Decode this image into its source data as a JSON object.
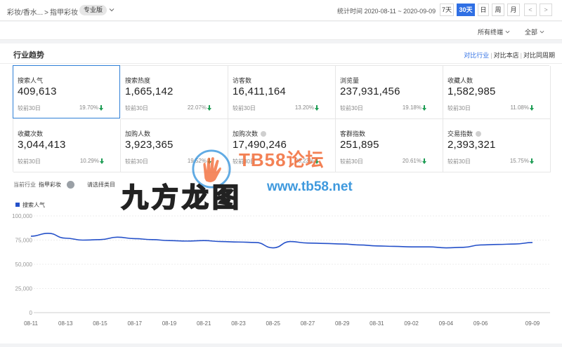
{
  "header": {
    "breadcrumb_1": "彩妆/香水...",
    "breadcrumb_sep": ">",
    "breadcrumb_2": "指甲彩妆",
    "edition_badge": "专业版",
    "stat_time": "统计时间 2020-08-11 ~ 2020-09-09",
    "ranges": [
      {
        "label": "7天",
        "active": false
      },
      {
        "label": "30天",
        "active": true
      },
      {
        "label": "日",
        "active": false
      },
      {
        "label": "周",
        "active": false
      },
      {
        "label": "月",
        "active": false
      },
      {
        "label": "<",
        "active": false
      },
      {
        "label": ">",
        "active": false
      }
    ]
  },
  "filters": {
    "terminal": "所有终端",
    "scope": "全部"
  },
  "panel": {
    "title": "行业趋势",
    "compare_industry": "对比行业",
    "compare_store": "对比本店",
    "compare_period": "对比同周期"
  },
  "metrics": [
    {
      "label": "搜索人气",
      "value": "409,613",
      "compare": "较前30日",
      "pct": "19.70%",
      "info": false,
      "selected": true
    },
    {
      "label": "搜索热度",
      "value": "1,665,142",
      "compare": "较前30日",
      "pct": "22.07%",
      "info": false,
      "selected": false
    },
    {
      "label": "访客数",
      "value": "16,411,164",
      "compare": "较前30日",
      "pct": "13.20%",
      "info": false,
      "selected": false
    },
    {
      "label": "浏览量",
      "value": "237,931,456",
      "compare": "较前30日",
      "pct": "19.18%",
      "info": false,
      "selected": false
    },
    {
      "label": "收藏人数",
      "value": "1,582,985",
      "compare": "较前30日",
      "pct": "11.08%",
      "info": false,
      "selected": false
    },
    {
      "label": "收藏次数",
      "value": "3,044,413",
      "compare": "较前30日",
      "pct": "10.29%",
      "info": false,
      "selected": false
    },
    {
      "label": "加购人数",
      "value": "3,923,365",
      "compare": "较前30日",
      "pct": "19.52%",
      "info": false,
      "selected": false
    },
    {
      "label": "加购次数",
      "value": "17,490,246",
      "compare": "较前30日",
      "pct": "20.23%",
      "info": true,
      "selected": false
    },
    {
      "label": "客群指数",
      "value": "251,895",
      "compare": "较前30日",
      "pct": "20.61%",
      "info": false,
      "selected": false
    },
    {
      "label": "交易指数",
      "value": "2,393,321",
      "compare": "较前30日",
      "pct": "15.75%",
      "info": true,
      "selected": false
    }
  ],
  "colors": {
    "accent": "#2f6fe4",
    "down_arrow": "#1f9d55",
    "series": "#2450c9"
  },
  "chart_header": {
    "current_label": "当前行业",
    "current_value": "指甲彩妆",
    "category_picker": "请选择类目"
  },
  "watermark": {
    "line1": "TB58论坛",
    "line2": "www.tb58.net",
    "line3": "九方龙图"
  },
  "chart_data": {
    "type": "line",
    "x": [
      "08-11",
      "08-12",
      "08-13",
      "08-14",
      "08-15",
      "08-16",
      "08-17",
      "08-18",
      "08-19",
      "08-20",
      "08-21",
      "08-22",
      "08-23",
      "08-24",
      "08-25",
      "08-26",
      "08-27",
      "08-28",
      "08-29",
      "08-30",
      "08-31",
      "09-01",
      "09-02",
      "09-03",
      "09-04",
      "09-05",
      "09-06",
      "09-07",
      "09-08",
      "09-09"
    ],
    "xticks": [
      "08-11",
      "08-13",
      "08-15",
      "08-17",
      "08-19",
      "08-21",
      "08-23",
      "08-25",
      "08-27",
      "08-29",
      "08-31",
      "09-02",
      "09-04",
      "09-06",
      "09-09"
    ],
    "series": [
      {
        "name": "搜索人气",
        "values": [
          79000,
          82000,
          77000,
          75000,
          75500,
          78000,
          76500,
          75500,
          74500,
          74000,
          74500,
          73500,
          73000,
          72500,
          67000,
          73500,
          72000,
          71500,
          71000,
          70000,
          69000,
          68500,
          68000,
          68000,
          67000,
          67500,
          70000,
          70500,
          71000,
          72500
        ]
      }
    ],
    "yticks": [
      "0",
      "25,000",
      "50,000",
      "75,000",
      "100,000"
    ],
    "ylim": [
      0,
      100000
    ],
    "grid": true,
    "legend": "top-left"
  }
}
